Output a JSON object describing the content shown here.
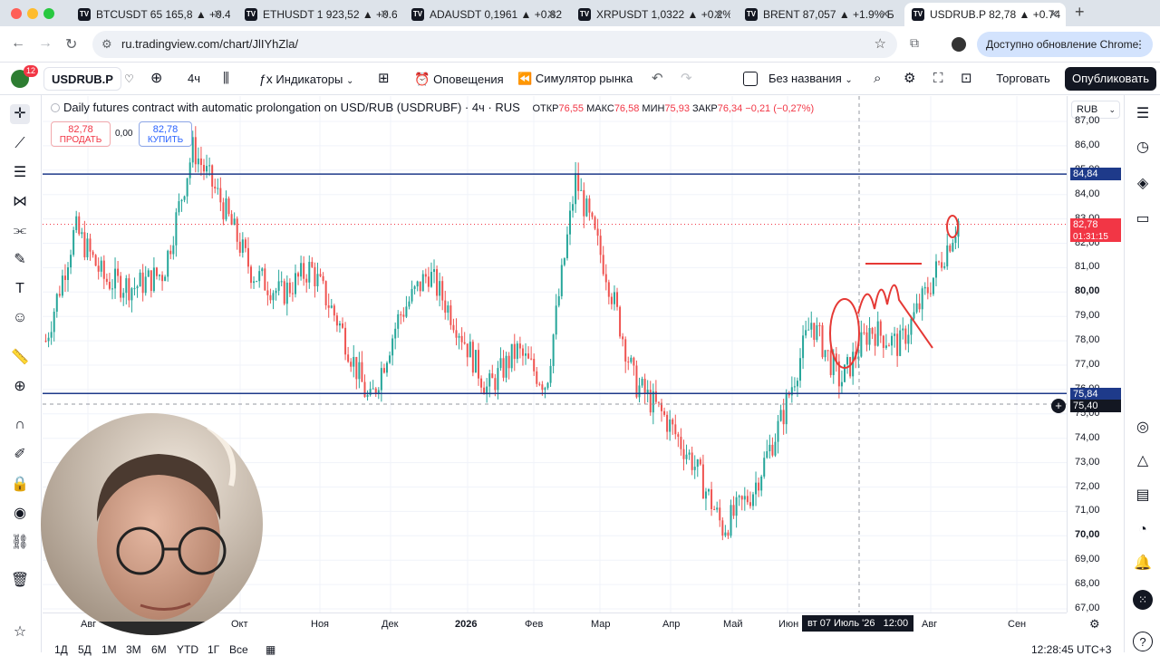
{
  "browser": {
    "tabs": [
      {
        "label": "BTCUSDT 65 165,8 ▲ +0.4",
        "active": false
      },
      {
        "label": "ETHUSDT 1 923,52 ▲ +0.6",
        "active": false
      },
      {
        "label": "ADAUSDT 0,1961 ▲ +0.82",
        "active": false
      },
      {
        "label": "XRPUSDT 1,0322 ▲ +0.2%",
        "active": false
      },
      {
        "label": "BRENT 87,057 ▲ +1.9% Б",
        "active": false
      },
      {
        "label": "USDRUB.P 82,78 ▲ +0.74",
        "active": true
      }
    ],
    "url": "ru.tradingview.com/chart/JlIYhZla/",
    "update_label": "Доступно обновление Chrome"
  },
  "toolbar": {
    "symbol": "USDRUB.P",
    "notifications_count": "12",
    "interval": "4ч",
    "indicators": "Индикаторы",
    "alerts": "Оповещения",
    "replay": "Симулятор рынка",
    "layout_name": "Без названия",
    "trade_label": "Торговать",
    "publish_label": "Опубликовать"
  },
  "legend": {
    "title": "Daily futures contract with automatic prolongation on USD/RUB (USDRUBF) · 4ч · RUS",
    "open_label": "ОТКР",
    "open": "76,55",
    "high_label": "МАКС",
    "high": "76,58",
    "low_label": "МИН",
    "low": "75,93",
    "close_label": "ЗАКР",
    "close": "76,34",
    "change": "−0,21 (−0,27%)",
    "sell_price": "82,78",
    "sell_label": "ПРОДАТЬ",
    "spread": "0,00",
    "buy_price": "82,78",
    "buy_label": "КУПИТЬ"
  },
  "price_axis": {
    "currency": "RUB",
    "labels": [
      "87,00",
      "86,00",
      "85,00",
      "84,00",
      "83,00",
      "82,00",
      "81,00",
      "80,00",
      "79,00",
      "78,00",
      "77,00",
      "76,00",
      "75,00",
      "74,00",
      "73,00",
      "72,00",
      "71,00",
      "70,00",
      "69,00",
      "68,00",
      "67,00"
    ],
    "line_high_tag": "84,84",
    "current_tag": "82,78",
    "countdown": "01:31:15",
    "line_low_tag": "75,84",
    "cursor_tag": "75,40"
  },
  "time_axis": {
    "labels": [
      "Авг",
      "Окт",
      "Ноя",
      "Дек",
      "2026",
      "Фев",
      "Мар",
      "Апр",
      "Май",
      "Июн",
      "Авг",
      "Сен"
    ],
    "cursor_label": "вт 07 Июль '26   12:00"
  },
  "bottom_bar": {
    "ranges": [
      "1Д",
      "5Д",
      "1М",
      "3М",
      "6М",
      "YTD",
      "1Г",
      "Все"
    ],
    "clock": "12:28:45 UTC+3"
  },
  "chart_data": {
    "type": "line",
    "title": "Daily futures contract with automatic prolongation on USD/RUB (USDRUBF) · 4ч · RUS",
    "x": [
      "Авг",
      "Сен",
      "Окт",
      "Ноя",
      "Дек",
      "2026",
      "Фев",
      "Мар",
      "Апр",
      "Май",
      "Июн",
      "Июл",
      "Авг",
      "Сен"
    ],
    "series": [
      {
        "values": [
          78.0,
          82.6,
          80.5,
          80.2,
          80.8,
          85.9,
          83.6,
          80.8,
          79.9,
          81.0,
          78.6,
          75.4,
          79.0,
          80.8,
          78.6,
          76.0,
          77.6,
          76.2,
          84.6,
          81.0,
          76.3,
          74.9,
          73.0,
          70.3,
          71.8,
          74.8,
          78.8,
          76.3,
          78.5,
          77.8,
          80.2,
          82.9
        ]
      }
    ],
    "hlines": [
      84.84,
      75.84
    ],
    "current": 82.78,
    "ylim": [
      67,
      87
    ],
    "grid": true
  },
  "colors": {
    "hline": "#1e3a8a",
    "candle_up": "#26a69a",
    "candle_down": "#ef5350",
    "price_tag_red": "#f23645",
    "annotation": "#e53935",
    "accent_blue": "#2962ff"
  }
}
